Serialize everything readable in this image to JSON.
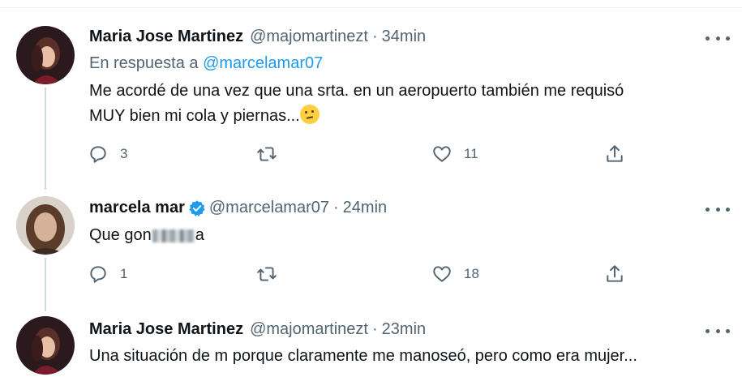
{
  "tweets": [
    {
      "name": "Maria Jose Martinez",
      "handle": "@majomartinezt",
      "separator": "·",
      "time": "34min",
      "reply_prefix": "En respuesta a",
      "reply_handle": "@marcelamar07",
      "text_line1": "Me acordé de una vez que una srta. en un aeropuerto también me requisó",
      "text_line2": "MUY bien mi cola y piernas...",
      "emoji": "thinking-face-emoji",
      "replies": "3",
      "retweets": "",
      "likes": "11",
      "verified": false
    },
    {
      "name": "marcela mar",
      "handle": "@marcelamar07",
      "separator": "·",
      "time": "24min",
      "text_start": "Que gon",
      "text_end": "a",
      "replies": "1",
      "retweets": "",
      "likes": "18",
      "verified": true
    },
    {
      "name": "Maria Jose Martinez",
      "handle": "@majomartinezt",
      "separator": "·",
      "time": "23min",
      "text_line1": "Una situación de m porque claramente me manoseó, pero como era mujer...",
      "verified": false
    }
  ],
  "colors": {
    "link": "#1d9bf0",
    "secondary_text": "#536471",
    "thread_line": "#cfd9de",
    "verified_badge": "#1d9bf0"
  }
}
